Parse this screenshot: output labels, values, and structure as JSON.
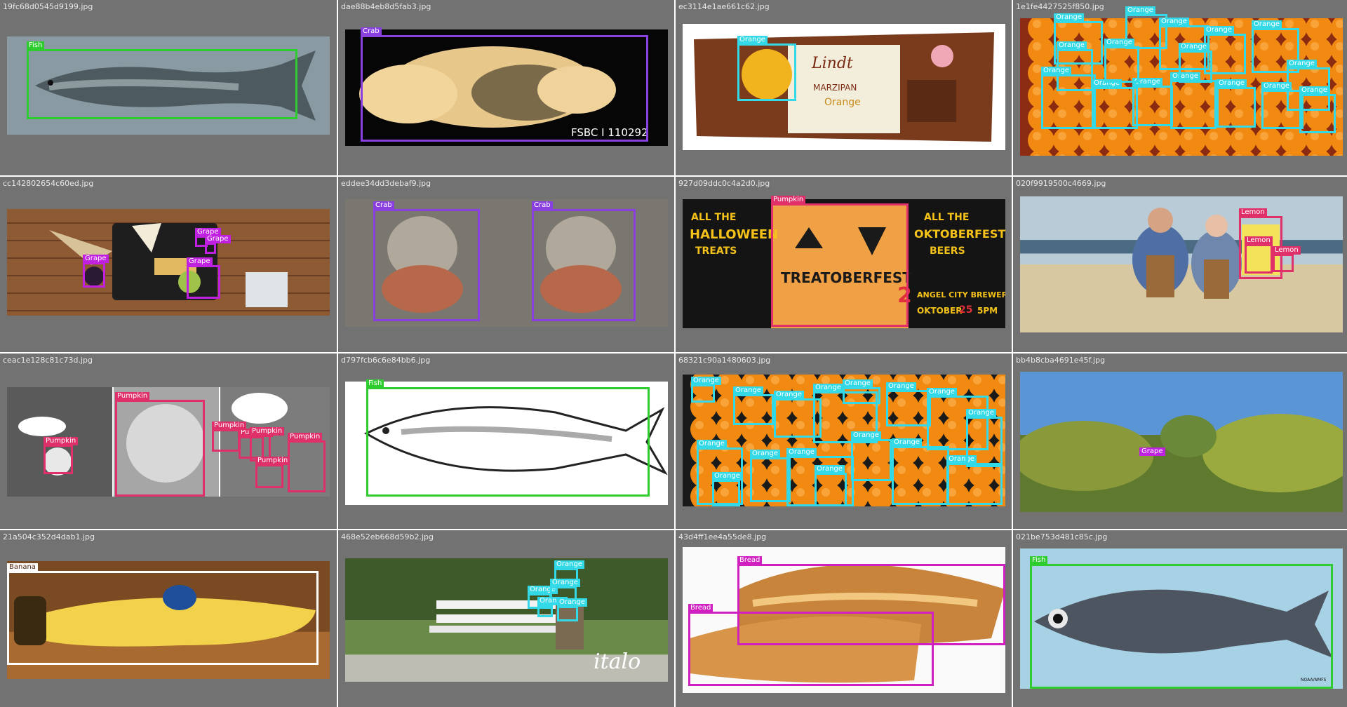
{
  "gallery": {
    "cells": [
      {
        "filename": "19fc68d0545d9199.jpg",
        "scene": "fish",
        "boxes": [
          {
            "label": "Fish",
            "color": "#2ecc2e"
          }
        ]
      },
      {
        "filename": "dae88b4eb8d5fab3.jpg",
        "scene": "crab-black",
        "texts": [
          "FSBC I 110292"
        ],
        "boxes": [
          {
            "label": "Crab",
            "color": "#8a3fe0"
          }
        ]
      },
      {
        "filename": "ec3114e1ae661c62.jpg",
        "scene": "lindt",
        "texts": [
          "Lindt",
          "MARZIPAN",
          "Orange"
        ],
        "boxes": [
          {
            "label": "Orange",
            "color": "#33d9e6"
          }
        ]
      },
      {
        "filename": "1e1fe4427525f850.jpg",
        "scene": "oranges-pile",
        "boxes": [
          {
            "label": "Orange",
            "color": "#33d9e6"
          },
          {
            "label": "Orange",
            "color": "#33d9e6"
          },
          {
            "label": "Orange",
            "color": "#33d9e6"
          },
          {
            "label": "Orange",
            "color": "#33d9e6"
          },
          {
            "label": "Orange",
            "color": "#33d9e6"
          },
          {
            "label": "Orange",
            "color": "#33d9e6"
          },
          {
            "label": "Orange",
            "color": "#33d9e6"
          },
          {
            "label": "Orange",
            "color": "#33d9e6"
          },
          {
            "label": "Orange",
            "color": "#33d9e6"
          },
          {
            "label": "Orange",
            "color": "#33d9e6"
          },
          {
            "label": "Orange",
            "color": "#33d9e6"
          },
          {
            "label": "Orange",
            "color": "#33d9e6"
          },
          {
            "label": "Orange",
            "color": "#33d9e6"
          },
          {
            "label": "Orange",
            "color": "#33d9e6"
          },
          {
            "label": "Orange",
            "color": "#33d9e6"
          },
          {
            "label": "Orange",
            "color": "#33d9e6"
          }
        ]
      },
      {
        "filename": "cc142802654c60ed.jpg",
        "scene": "cheese-board",
        "boxes": [
          {
            "label": "Grape",
            "color": "#c020e0"
          },
          {
            "label": "Grape",
            "color": "#c020e0"
          },
          {
            "label": "Grape",
            "color": "#c020e0"
          },
          {
            "label": "Grape",
            "color": "#c020e0"
          }
        ]
      },
      {
        "filename": "eddee34dd3debaf9.jpg",
        "scene": "hermit-crabs",
        "boxes": [
          {
            "label": "Crab",
            "color": "#8a3fe0"
          },
          {
            "label": "Crab",
            "color": "#8a3fe0"
          }
        ]
      },
      {
        "filename": "927d09ddc0c4a2d0.jpg",
        "scene": "poster",
        "texts": [
          "ALL THE",
          "HALLOWEEN",
          "TREATS",
          "ALL THE",
          "OKTOBERFEST",
          "BEERS",
          "TREATOBERFEST",
          "2",
          "ANGEL CITY BREWERY",
          "OKTOBER",
          "25",
          "5PM"
        ],
        "boxes": [
          {
            "label": "Pumpkin",
            "color": "#e0306a"
          }
        ]
      },
      {
        "filename": "020f9919500c4669.jpg",
        "scene": "bar",
        "boxes": [
          {
            "label": "Lemon",
            "color": "#e0306a"
          },
          {
            "label": "Lemon",
            "color": "#e0306a"
          },
          {
            "label": "Lemon",
            "color": "#e0306a"
          }
        ]
      },
      {
        "filename": "ceac1e128c81c73d.jpg",
        "scene": "comic",
        "boxes": [
          {
            "label": "Pumpkin",
            "color": "#e0306a"
          },
          {
            "label": "Pumpkin",
            "color": "#e0306a"
          },
          {
            "label": "Pumpkin",
            "color": "#e0306a"
          },
          {
            "label": "Pumpkin",
            "color": "#e0306a"
          },
          {
            "label": "Pumpkin",
            "color": "#e0306a"
          },
          {
            "label": "Pumpkin",
            "color": "#e0306a"
          },
          {
            "label": "Pumpkin",
            "color": "#e0306a"
          }
        ]
      },
      {
        "filename": "d797fcb6c6e84bb6.jpg",
        "scene": "fish-sketch",
        "boxes": [
          {
            "label": "Fish",
            "color": "#2ecc2e"
          }
        ]
      },
      {
        "filename": "68321c90a1480603.jpg",
        "scene": "oranges-crate",
        "boxes": [
          {
            "label": "Orange",
            "color": "#33d9e6"
          },
          {
            "label": "Orange",
            "color": "#33d9e6"
          },
          {
            "label": "Orange",
            "color": "#33d9e6"
          },
          {
            "label": "Orange",
            "color": "#33d9e6"
          },
          {
            "label": "Orange",
            "color": "#33d9e6"
          },
          {
            "label": "Orange",
            "color": "#33d9e6"
          },
          {
            "label": "Orange",
            "color": "#33d9e6"
          },
          {
            "label": "Orange",
            "color": "#33d9e6"
          },
          {
            "label": "Orange",
            "color": "#33d9e6"
          },
          {
            "label": "Orange",
            "color": "#33d9e6"
          },
          {
            "label": "Orange",
            "color": "#33d9e6"
          },
          {
            "label": "Orange",
            "color": "#33d9e6"
          },
          {
            "label": "Orange",
            "color": "#33d9e6"
          },
          {
            "label": "Orange",
            "color": "#33d9e6"
          },
          {
            "label": "Orange",
            "color": "#33d9e6"
          },
          {
            "label": "Orange",
            "color": "#33d9e6"
          }
        ]
      },
      {
        "filename": "bb4b8cba4691e45f.jpg",
        "scene": "vineyard",
        "boxes": [
          {
            "label": "Grape",
            "color": "#c020e0"
          }
        ]
      },
      {
        "filename": "21a504c352d4dab1.jpg",
        "scene": "banana",
        "boxes": [
          {
            "label": "Banana",
            "color": "#ffffff",
            "label_color": "#5a2a10"
          }
        ]
      },
      {
        "filename": "468e52eb668d59b2.jpg",
        "scene": "bench",
        "texts": [
          "italo"
        ],
        "boxes": [
          {
            "label": "Orange",
            "color": "#33d9e6"
          },
          {
            "label": "Orange",
            "color": "#33d9e6"
          },
          {
            "label": "Orange",
            "color": "#33d9e6"
          },
          {
            "label": "Orange",
            "color": "#33d9e6"
          },
          {
            "label": "Orange",
            "color": "#33d9e6"
          }
        ]
      },
      {
        "filename": "43d4ff1ee4a55de8.jpg",
        "scene": "bread",
        "boxes": [
          {
            "label": "Bread",
            "color": "#d020c0"
          },
          {
            "label": "Bread",
            "color": "#d020c0"
          }
        ]
      },
      {
        "filename": "021be753d481c85c.jpg",
        "scene": "fish-blue",
        "texts": [
          "NOAA/NMFS"
        ],
        "boxes": [
          {
            "label": "Fish",
            "color": "#2ecc2e"
          }
        ]
      }
    ]
  }
}
